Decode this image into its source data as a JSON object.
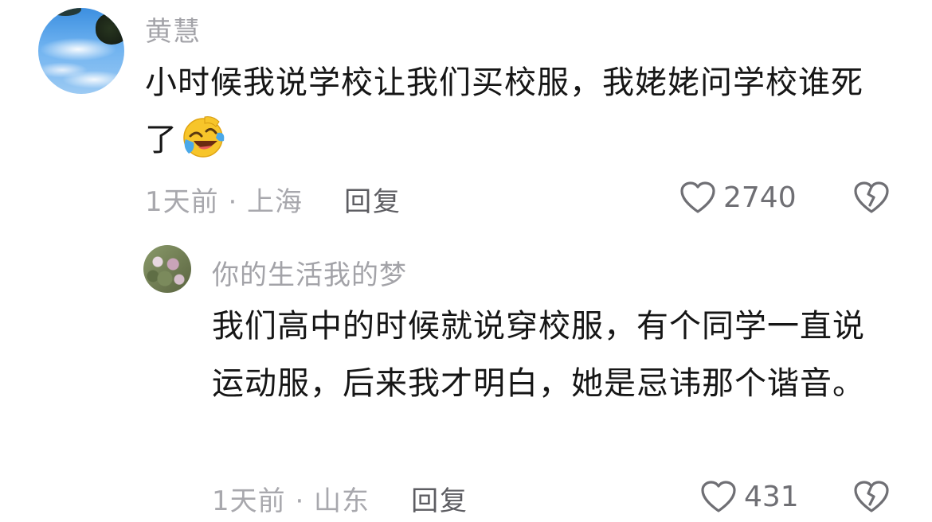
{
  "comments": [
    {
      "username": "黄慧",
      "text": "小时候我说学校让我们买校服，我姥姥问学校谁死了",
      "emoji": "face-with-tears-of-joy-icon",
      "time_location": "1天前 · 上海",
      "reply_label": "回复",
      "likes": "2740"
    }
  ],
  "replies": [
    {
      "username": "你的生活我的梦",
      "text": "我们高中的时候就说穿校服，有个同学一直说运动服，后来我才明白，她是忌讳那个谐音。",
      "time_location": "1天前 · 山东",
      "reply_label": "回复",
      "likes": "431"
    }
  ],
  "icons": {
    "like": "heart-outline-icon",
    "dislike": "broken-heart-icon"
  },
  "colors": {
    "text_primary": "#161616",
    "text_secondary": "#a3a3a8",
    "icon_gray": "#6f6f74"
  }
}
